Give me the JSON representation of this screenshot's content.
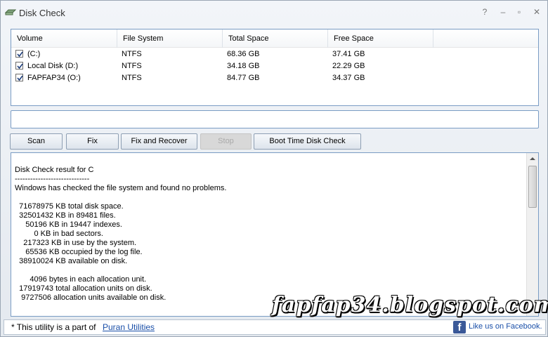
{
  "window": {
    "title": "Disk Check",
    "controls": [
      "?",
      "–",
      "▫",
      "✕"
    ]
  },
  "volumes": {
    "headers": [
      "Volume",
      "File System",
      "Total Space",
      "Free Space"
    ],
    "rows": [
      {
        "checked": true,
        "volume": "(C:)",
        "fs": "NTFS",
        "total": "68.36 GB",
        "free": "37.41 GB"
      },
      {
        "checked": true,
        "volume": "Local Disk (D:)",
        "fs": "NTFS",
        "total": "34.18 GB",
        "free": "22.29 GB"
      },
      {
        "checked": true,
        "volume": "FAPFAP34 (O:)",
        "fs": "NTFS",
        "total": "84.77 GB",
        "free": "34.37 GB"
      }
    ]
  },
  "path_field": {
    "value": ""
  },
  "buttons": {
    "scan": "Scan",
    "fix": "Fix",
    "fix_recover": "Fix and Recover",
    "stop": "Stop",
    "boot_check": "Boot Time Disk Check"
  },
  "output": {
    "text": "Disk Check result for C\n-----------------------------\nWindows has checked the file system and found no problems.\n\n  71678975 KB total disk space.\n  32501432 KB in 89481 files.\n     50196 KB in 19447 indexes.\n         0 KB in bad sectors.\n    217323 KB in use by the system.\n     65536 KB occupied by the log file.\n  38910024 KB available on disk.\n\n       4096 bytes in each allocation unit.\n  17919743 total allocation units on disk.\n   9727506 allocation units available on disk."
  },
  "status": {
    "text": "* This utility is a part of",
    "link": "Puran Utilities",
    "facebook": "Like us on Facebook."
  },
  "watermark": "fapfap34.blogspot.com",
  "colors": {
    "accent_border": "#7a9cc4",
    "link": "#1a4fa8",
    "facebook": "#3b5998"
  }
}
